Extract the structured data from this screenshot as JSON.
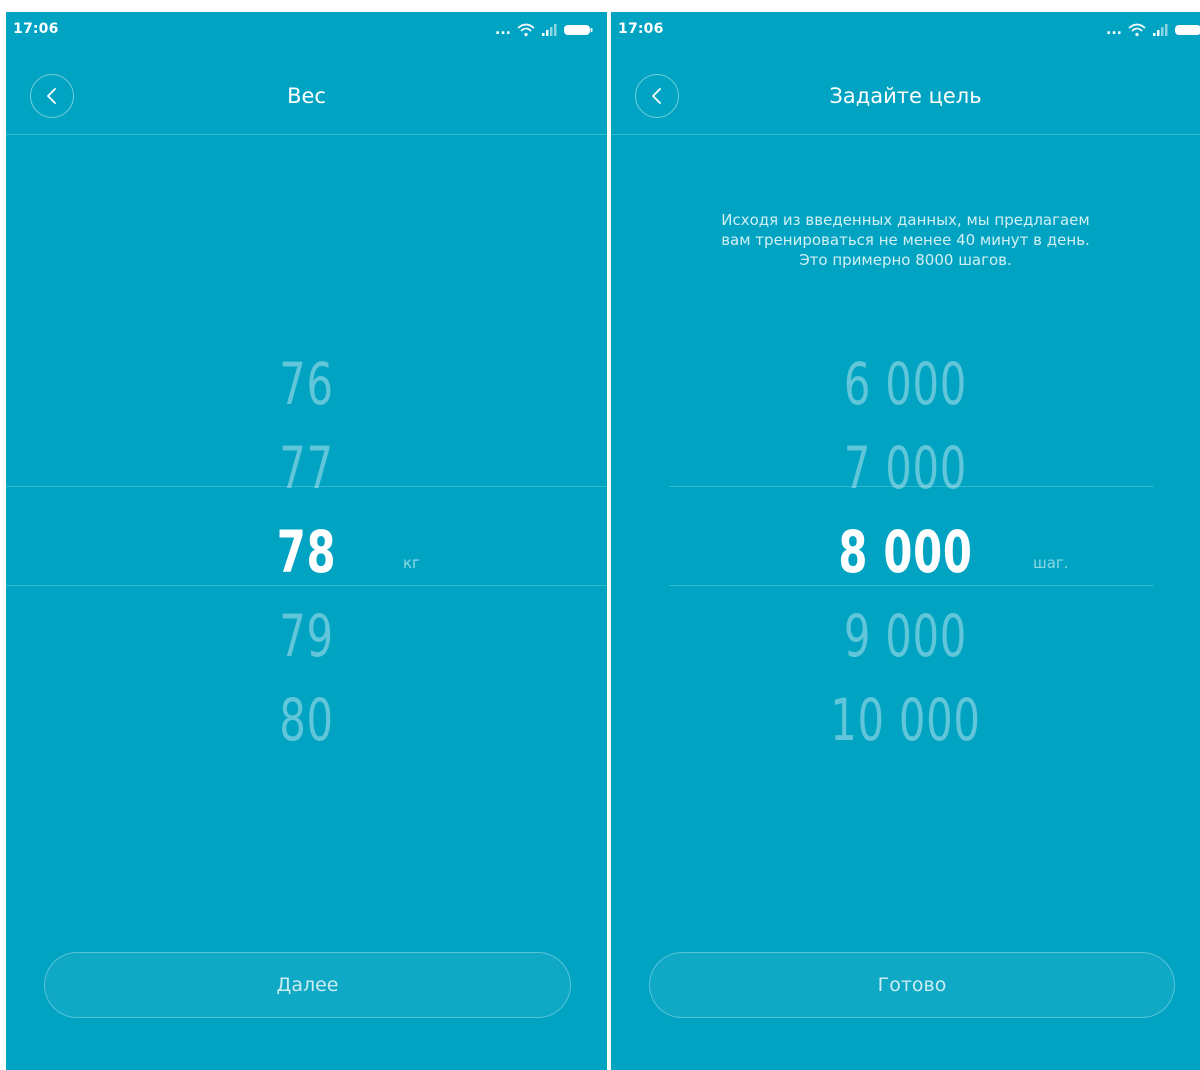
{
  "screens": [
    {
      "status_time": "17:06",
      "title": "Вес",
      "picker": {
        "values": [
          "76",
          "77",
          "78",
          "79",
          "80"
        ],
        "selected_index": 2,
        "unit": "кг"
      },
      "action_label": "Далее"
    },
    {
      "status_time": "17:06",
      "title": "Задайте цель",
      "hint_lines": [
        "Исходя из введенных данных, мы предлагаем",
        "вам тренироваться не менее 40 минут в день.",
        "Это примерно 8000 шагов."
      ],
      "picker": {
        "values": [
          "6 000",
          "7 000",
          "8 000",
          "9 000",
          "10 000"
        ],
        "selected_index": 2,
        "unit": "шаг."
      },
      "action_label": "Готово"
    }
  ],
  "icons": {
    "back": "chevron-left-icon",
    "status": [
      "more-dots-icon",
      "wifi-icon",
      "signal-icon",
      "battery-icon"
    ]
  },
  "colors": {
    "background": "#00a4c2",
    "text": "#ffffff"
  }
}
